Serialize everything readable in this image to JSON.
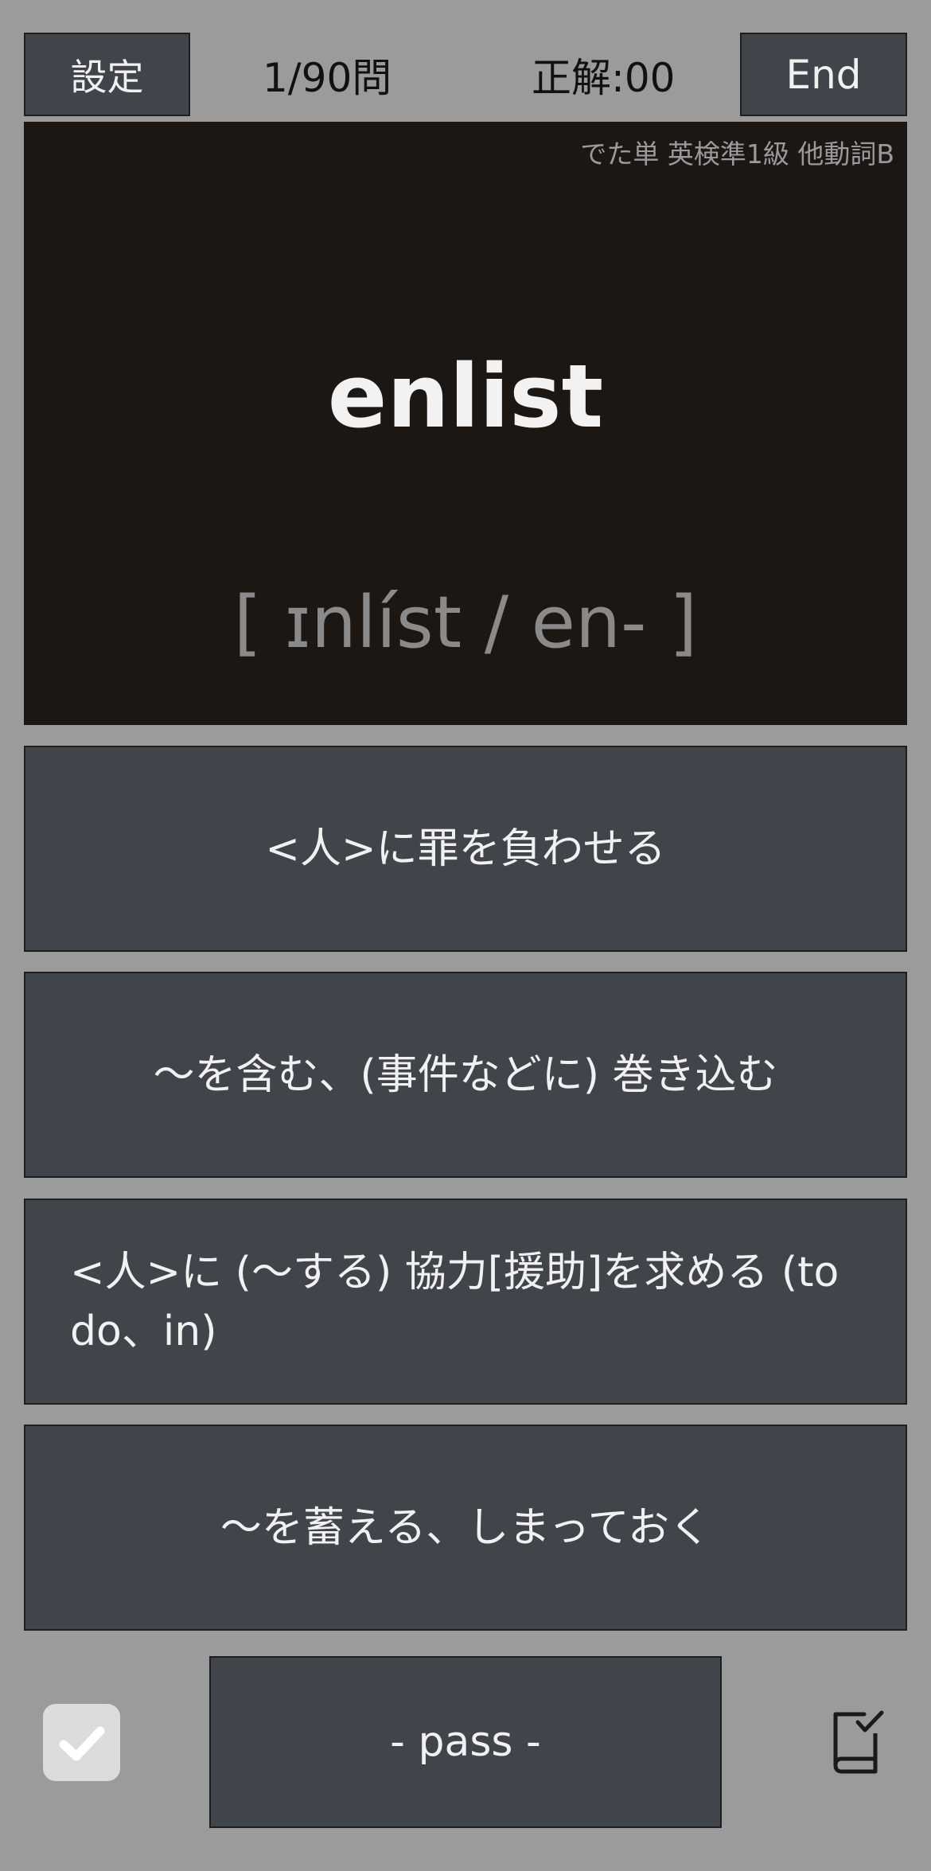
{
  "header": {
    "settings_label": "設定",
    "progress": "1/90問",
    "score": "正解:00",
    "end_label": "End"
  },
  "card": {
    "source": "でた単 英検準1級  他動詞B",
    "word": "enlist",
    "pronunciation": "[ ɪnlíst / en- ]"
  },
  "choices": [
    "<人>に罪を負わせる",
    "～を含む、(事件などに) 巻き込む",
    "<人>に (～する) 協力[援助]を求める (to do、in)",
    "～を蓄える、しまっておく"
  ],
  "footer": {
    "pass_label": "- pass -",
    "check_icon": "checkmark-icon",
    "wordbook_icon": "book-check-icon"
  },
  "colors": {
    "background": "#9b9b9b",
    "button": "#40444b",
    "card": "#1d1714"
  }
}
